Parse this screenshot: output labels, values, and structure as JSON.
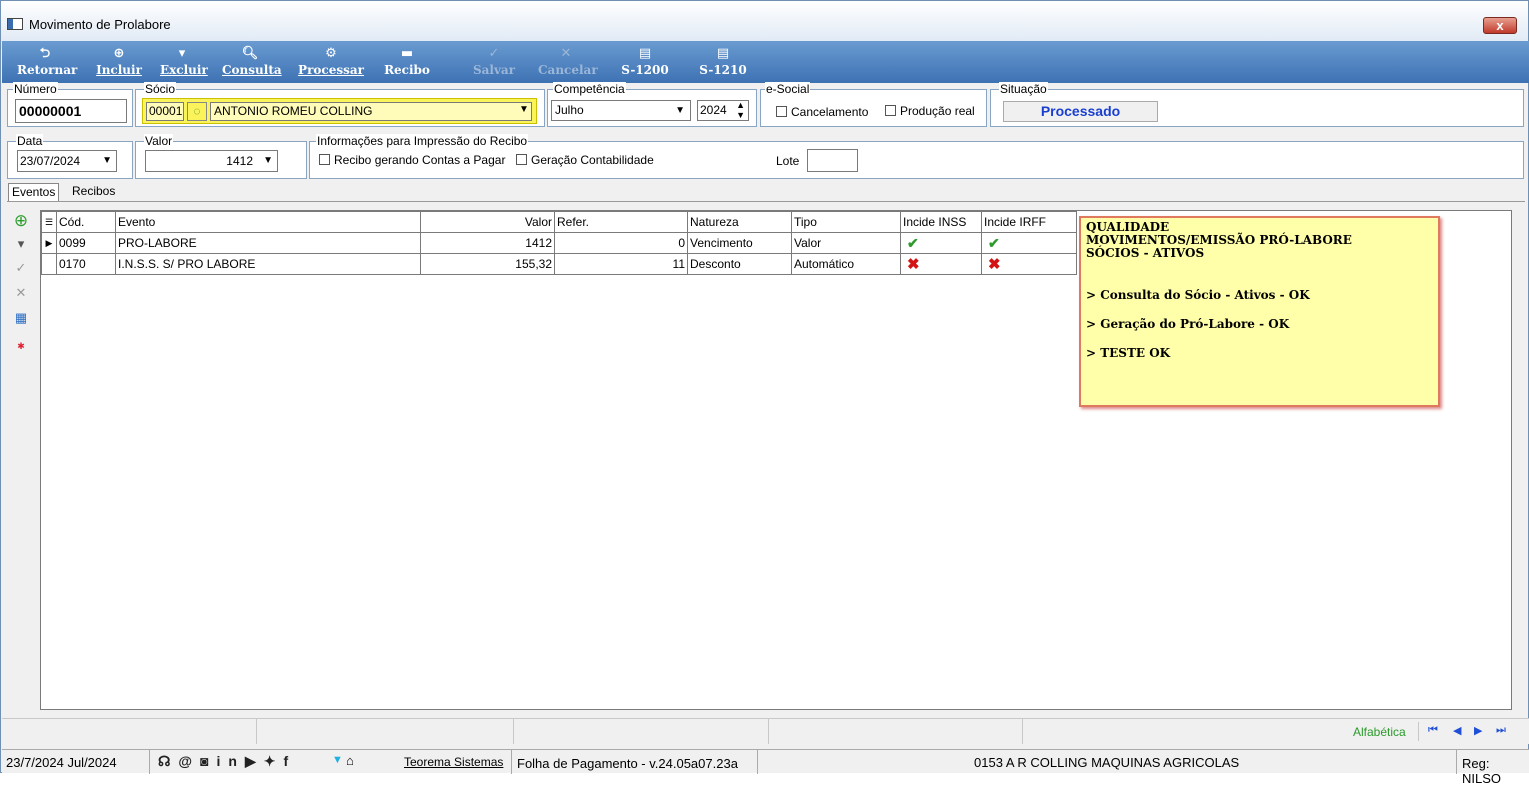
{
  "window": {
    "title": "Movimento de Prolabore",
    "close": "x"
  },
  "toolbar": [
    {
      "label": "Retornar",
      "icon": "back-arrow-icon",
      "glyph": "⮌",
      "enabled": true
    },
    {
      "label": "Incluir",
      "icon": "add-icon",
      "glyph": "⊕",
      "enabled": true
    },
    {
      "label": "Excluir",
      "icon": "trash-icon",
      "glyph": "▾",
      "enabled": true
    },
    {
      "label": "Consulta",
      "icon": "search-icon",
      "glyph": "🔍︎",
      "enabled": true
    },
    {
      "label": "Processar",
      "icon": "gear-icon",
      "glyph": "⚙",
      "enabled": true
    },
    {
      "label": "Recibo",
      "icon": "printer-icon",
      "glyph": "▬",
      "enabled": true
    },
    {
      "label": "Salvar",
      "icon": "check-icon",
      "glyph": "✓",
      "enabled": false
    },
    {
      "label": "Cancelar",
      "icon": "cancel-icon",
      "glyph": "✕",
      "enabled": false
    },
    {
      "label": "S-1200",
      "icon": "document-gear-icon",
      "glyph": "▤",
      "enabled": true
    },
    {
      "label": "S-1210",
      "icon": "document-gear-icon",
      "glyph": "▤",
      "enabled": true
    }
  ],
  "form": {
    "numero": {
      "label": "Número",
      "value": "00000001"
    },
    "socio": {
      "label": "Sócio",
      "code": "00001",
      "name": "ANTONIO ROMEU COLLING"
    },
    "competencia": {
      "label": "Competência",
      "month": "Julho",
      "year": "2024"
    },
    "esocial": {
      "label": "e-Social",
      "cancelamento": "Cancelamento",
      "producao": "Produção real"
    },
    "situacao": {
      "label": "Situação",
      "value": "Processado"
    },
    "data": {
      "label": "Data",
      "value": "23/07/2024"
    },
    "valor": {
      "label": "Valor",
      "value": "1412"
    },
    "impressao": {
      "label": "Informações para Impressão do Recibo",
      "recibo": "Recibo gerando Contas a Pagar",
      "contab": "Geração Contabilidade",
      "lote": "Lote"
    }
  },
  "tabs": [
    "Eventos",
    "Recibos"
  ],
  "grid": {
    "headers": [
      "Cód.",
      "Evento",
      "Valor",
      "Refer.",
      "Natureza",
      "Tipo",
      "Incide INSS",
      "Incide IRFF"
    ],
    "rows": [
      {
        "cod": "0099",
        "evento": "PRO-LABORE",
        "valor": "1412",
        "refer": "0",
        "natureza": "Vencimento",
        "tipo": "Valor",
        "inss": "yes",
        "irff": "yes"
      },
      {
        "cod": "0170",
        "evento": "I.N.S.S. S/ PRO LABORE",
        "valor": "155,32",
        "refer": "11",
        "natureza": "Desconto",
        "tipo": "Automático",
        "inss": "no",
        "irff": "no"
      }
    ]
  },
  "note": {
    "line1": "QUALIDADE",
    "line2": "MOVIMENTOS/EMISSÃO PRÓ-LABORE",
    "line3": "SÓCIOS - ATIVOS",
    "item1": "> Consulta do Sócio - Ativos - OK",
    "item2": "> Geração do Pró-Labore - OK",
    "item3": "> TESTE OK"
  },
  "statusbar": {
    "order": "Alfabética"
  },
  "bottom": {
    "date": "23/7/2024 Jul/2024",
    "company": "Teorema Sistemas",
    "version": "Folha de Pagamento - v.24.05a07.23a",
    "client": "0153 A R COLLING MAQUINAS AGRICOLAS",
    "user": "Reg: NILSO"
  }
}
